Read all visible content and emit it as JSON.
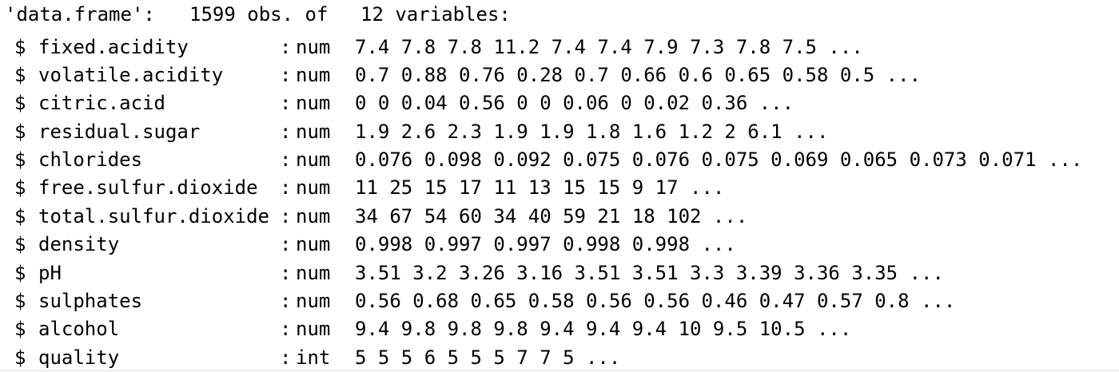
{
  "header": {
    "kind": "'data.frame':",
    "obs": "1599 obs. of",
    "vars": "12 variables:"
  },
  "rows": [
    {
      "dollar": "$",
      "name": "fixed.acidity",
      "colon": ":",
      "type": "num",
      "values": "7.4 7.8 7.8 11.2 7.4 7.4 7.9 7.3 7.8 7.5 ..."
    },
    {
      "dollar": "$",
      "name": "volatile.acidity",
      "colon": ":",
      "type": "num",
      "values": "0.7 0.88 0.76 0.28 0.7 0.66 0.6 0.65 0.58 0.5 ..."
    },
    {
      "dollar": "$",
      "name": "citric.acid",
      "colon": ":",
      "type": "num",
      "values": "0 0 0.04 0.56 0 0 0.06 0 0.02 0.36 ..."
    },
    {
      "dollar": "$",
      "name": "residual.sugar",
      "colon": ":",
      "type": "num",
      "values": "1.9 2.6 2.3 1.9 1.9 1.8 1.6 1.2 2 6.1 ..."
    },
    {
      "dollar": "$",
      "name": "chlorides",
      "colon": ":",
      "type": "num",
      "values": "0.076 0.098 0.092 0.075 0.076 0.075 0.069 0.065 0.073 0.071 ..."
    },
    {
      "dollar": "$",
      "name": "free.sulfur.dioxide",
      "colon": ":",
      "type": "num",
      "values": "11 25 15 17 11 13 15 15 9 17 ..."
    },
    {
      "dollar": "$",
      "name": "total.sulfur.dioxide",
      "colon": ":",
      "type": "num",
      "values": "34 67 54 60 34 40 59 21 18 102 ..."
    },
    {
      "dollar": "$",
      "name": "density",
      "colon": ":",
      "type": "num",
      "values": "0.998 0.997 0.997 0.998 0.998 ..."
    },
    {
      "dollar": "$",
      "name": "pH",
      "colon": ":",
      "type": "num",
      "values": "3.51 3.2 3.26 3.16 3.51 3.51 3.3 3.39 3.36 3.35 ..."
    },
    {
      "dollar": "$",
      "name": "sulphates",
      "colon": ":",
      "type": "num",
      "values": "0.56 0.68 0.65 0.58 0.56 0.56 0.46 0.47 0.57 0.8 ..."
    },
    {
      "dollar": "$",
      "name": "alcohol",
      "colon": ":",
      "type": "num",
      "values": "9.4 9.8 9.8 9.8 9.4 9.4 9.4 10 9.5 10.5 ..."
    },
    {
      "dollar": "$",
      "name": "quality",
      "colon": ":",
      "type": "int",
      "values": "5 5 5 6 5 5 5 7 7 5 ..."
    }
  ]
}
